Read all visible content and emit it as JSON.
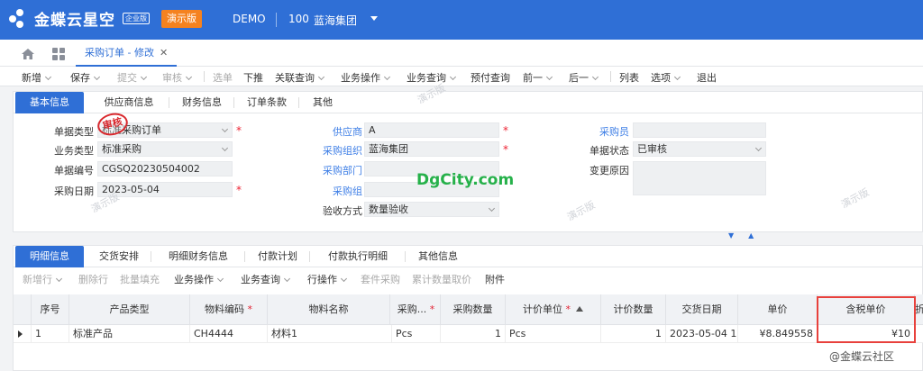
{
  "header": {
    "logo_text": "金蝶云星空",
    "edition": "企业版",
    "demo_badge": "演示版",
    "env": "DEMO",
    "org_code": "100",
    "org_name": "蓝海集团"
  },
  "tabbar": {
    "active_tab": "采购订单 - 修改",
    "close_glyph": "✕"
  },
  "toolbar": {
    "items": [
      "新增",
      "保存",
      "提交",
      "审核",
      "选单",
      "下推",
      "关联查询",
      "业务操作",
      "业务查询",
      "预付查询",
      "前一",
      "后一",
      "列表",
      "选项",
      "退出"
    ]
  },
  "header_tabs": [
    "基本信息",
    "供应商信息",
    "财务信息",
    "订单条款",
    "其他"
  ],
  "form": {
    "bill_type": {
      "label": "单据类型",
      "value": "标准采购订单"
    },
    "biz_type": {
      "label": "业务类型",
      "value": "标准采购"
    },
    "bill_no": {
      "label": "单据编号",
      "value": "CGSQ20230504002"
    },
    "purchase_date": {
      "label": "采购日期",
      "value": "2023-05-04"
    },
    "supplier": {
      "label": "供应商",
      "value": "A"
    },
    "purchase_org": {
      "label": "采购组织",
      "value": "蓝海集团"
    },
    "purchase_dept": {
      "label": "采购部门",
      "value": ""
    },
    "purchase_group": {
      "label": "采购组",
      "value": ""
    },
    "inspect_method": {
      "label": "验收方式",
      "value": "数量验收"
    },
    "purchaser": {
      "label": "采购员",
      "value": ""
    },
    "doc_status": {
      "label": "单据状态",
      "value": "已审核"
    },
    "change_reason": {
      "label": "变更原因",
      "value": ""
    }
  },
  "stamp_text": "审核",
  "watermark_text": "演示版",
  "brand_watermark": "DgCity.com",
  "detail_tabs": [
    "明细信息",
    "交货安排",
    "明细财务信息",
    "付款计划",
    "付款执行明细",
    "其他信息"
  ],
  "detail_toolbar": [
    "新增行",
    "删除行",
    "批量填充",
    "业务操作",
    "业务查询",
    "行操作",
    "套件采购",
    "累计数量取价",
    "附件"
  ],
  "grid": {
    "columns": [
      "序号",
      "产品类型",
      "物料编码",
      "物料名称",
      "采购...",
      "采购数量",
      "计价单位",
      "计价数量",
      "交货日期",
      "单价",
      "含税单价",
      "折"
    ],
    "rows": [
      [
        "1",
        "标准产品",
        "CH4444",
        "材料1",
        "Pcs",
        "1",
        "Pcs",
        "1",
        "2023-05-04 11:",
        "¥8.849558",
        "¥10",
        ""
      ]
    ]
  },
  "credit": "@金蝶云社区",
  "colors": {
    "primary": "#2f6fd6",
    "demo_badge": "#f5821f",
    "required": "#e22233",
    "highlight": "#e8413c",
    "stamp": "#d9282d"
  }
}
